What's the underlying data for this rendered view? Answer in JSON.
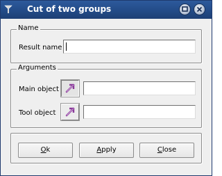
{
  "window": {
    "title": "Cut of two groups"
  },
  "name_group": {
    "legend": "Name",
    "result_name_label": "Result name",
    "result_name_value": ""
  },
  "arguments_group": {
    "legend": "Arguments",
    "main_object_label": "Main object",
    "main_object_value": "",
    "tool_object_label": "Tool object",
    "tool_object_value": ""
  },
  "buttons": {
    "ok": {
      "mnemonic": "O",
      "rest": "k"
    },
    "apply": {
      "mnemonic": "A",
      "rest": "pply"
    },
    "close": {
      "mnemonic": "C",
      "rest": "lose"
    }
  },
  "icons": {
    "app": "app-icon",
    "maximize": "maximize-icon",
    "close": "close-icon",
    "select": "select-arrow-icon"
  },
  "colors": {
    "titlebar": "#244d8a",
    "window_bg": "#efefef",
    "select_arrow": "#8a3a9a"
  }
}
